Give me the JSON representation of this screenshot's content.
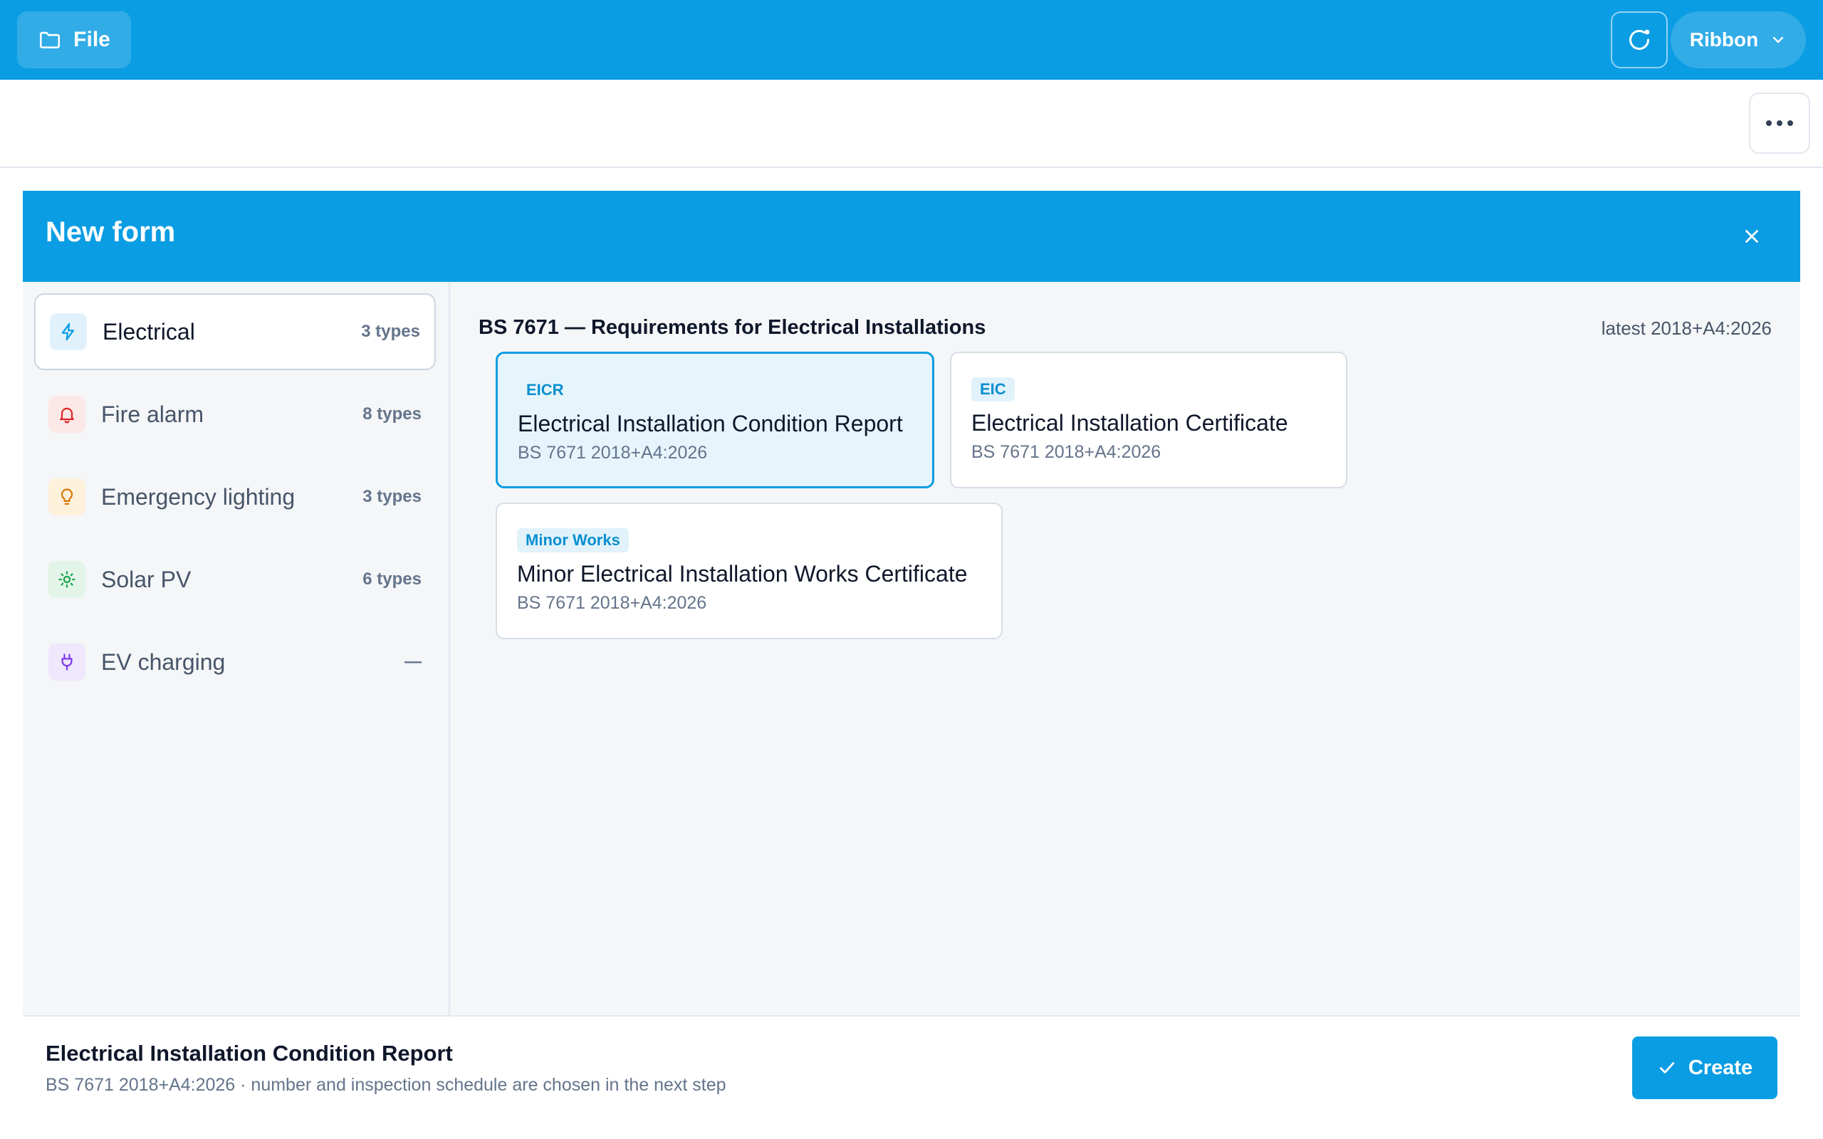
{
  "topbar": {
    "file_label": "File",
    "ribbon_label": "Ribbon",
    "bg_color": "#0a9de3"
  },
  "dialog": {
    "title": "New form",
    "sidebar": {
      "items": [
        {
          "label": "Electrical",
          "count": "3 types",
          "icon": "lightning-icon",
          "active": true,
          "accent": "#0a9de3"
        },
        {
          "label": "Fire alarm",
          "count": "8 types",
          "icon": "bell-icon",
          "active": false,
          "accent": "#dc2626"
        },
        {
          "label": "Emergency lighting",
          "count": "3 types",
          "icon": "lightbulb-icon",
          "active": false,
          "accent": "#d97706"
        },
        {
          "label": "Solar PV",
          "count": "6 types",
          "icon": "sun-icon",
          "active": false,
          "accent": "#16a34a"
        },
        {
          "label": "EV charging",
          "count": "—",
          "icon": "plug-icon",
          "active": false,
          "accent": "#7c3aed"
        }
      ]
    },
    "section": {
      "title": "BS 7671 — Requirements for Electrical Installations",
      "meta": "latest 2018+A4:2026"
    },
    "cards": [
      {
        "tag": "EICR",
        "title": "Electrical Installation Condition Report",
        "subtitle": "BS 7671 2018+A4:2026",
        "selected": true
      },
      {
        "tag": "EIC",
        "title": "Electrical Installation Certificate",
        "subtitle": "BS 7671 2018+A4:2026",
        "selected": false
      },
      {
        "tag": "Minor Works",
        "title": "Minor Electrical Installation Works Certificate",
        "subtitle": "BS 7671 2018+A4:2026",
        "selected": false
      }
    ],
    "footer": {
      "title": "Electrical Installation Condition Report",
      "subtitle": "BS 7671 2018+A4:2026 · number and inspection schedule are chosen in the next step",
      "create_label": "Create"
    }
  }
}
